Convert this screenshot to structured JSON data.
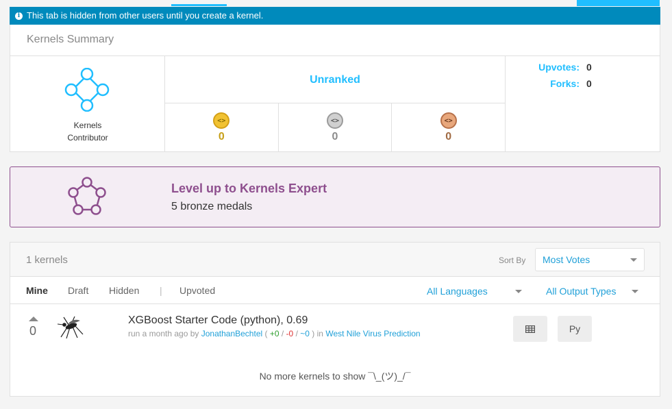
{
  "notice": {
    "text": "This tab is hidden from other users until you create a kernel."
  },
  "summary": {
    "title": "Kernels Summary",
    "tier": {
      "line1": "Kernels",
      "line2": "Contributor"
    },
    "rank": "Unranked",
    "medals": {
      "gold": "0",
      "silver": "0",
      "bronze": "0"
    },
    "stats": [
      {
        "label": "Upvotes:",
        "value": "0"
      },
      {
        "label": "Forks:",
        "value": "0"
      }
    ]
  },
  "levelup": {
    "title": "Level up to Kernels Expert",
    "subtitle": "5 bronze medals"
  },
  "kernels": {
    "count": "1 kernels",
    "sort_label": "Sort By",
    "sort_value": "Most Votes",
    "tabs": {
      "mine": "Mine",
      "draft": "Draft",
      "hidden": "Hidden",
      "sep": "|",
      "upvoted": "Upvoted"
    },
    "filters": {
      "languages": "All Languages",
      "output": "All Output Types"
    },
    "rows": [
      {
        "votes": "0",
        "title": "XGBoost Starter Code (python), 0.69",
        "meta_prefix": "run a month ago by",
        "author": "JonathanBechtel",
        "open_paren": "(",
        "plus": "+0",
        "sep1": "/",
        "minus": "-0",
        "sep2": "/",
        "tilde": "~0",
        "close_paren": ")",
        "in": "in",
        "competition": "West Nile Virus Prediction",
        "lang": "Py"
      }
    ],
    "no_more": "No more kernels to show ¯\\_(ツ)_/¯"
  },
  "colors": {
    "accent": "#20beff",
    "notice": "#008abc",
    "levelup": "#8e4f8e"
  }
}
